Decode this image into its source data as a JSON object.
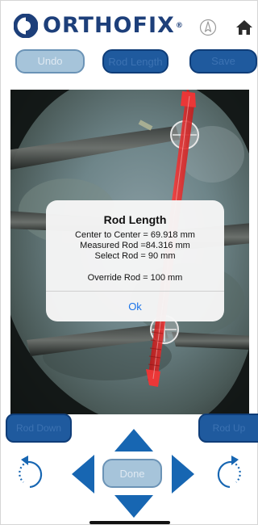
{
  "header": {
    "brand": "ORTHOFIX",
    "brand_mark": "®",
    "icons": [
      "compass-icon",
      "home-icon"
    ]
  },
  "toolbar": {
    "undo_label": "Undo",
    "rod_length_label": "Rod Length",
    "save_label": "Save"
  },
  "dialog": {
    "title": "Rod Length",
    "center_to_center": "Center to Center = 69.918 mm",
    "measured_rod": "Measured Rod =84.316 mm",
    "select_rod": "Select Rod = 90 mm",
    "override_rod": "Override Rod = 100 mm",
    "ok_label": "Ok"
  },
  "controls": {
    "rod_down_label": "Rod Down",
    "rod_up_label": "Rod Up",
    "done_label": "Done"
  },
  "colors": {
    "brand_navy": "#1d3f7a",
    "button_blue": "#1f5a9e",
    "disabled_blue": "#a6c4da",
    "arrow_blue": "#1766b2",
    "rod_red": "#e02020",
    "link_blue": "#1a73e8"
  }
}
